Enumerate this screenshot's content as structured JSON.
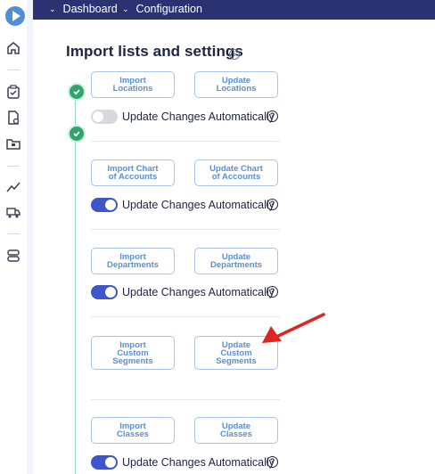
{
  "topbar": {
    "dashboard": "Dashboard",
    "configuration": "Configuration"
  },
  "page": {
    "title": "Import lists and settings",
    "info_icon": "i"
  },
  "sections": [
    {
      "import": "Import\nLocations",
      "update": "Update\nLocations",
      "toggle_label": "Update Changes Automatically",
      "toggle_on": false
    },
    {
      "import": "Import Chart\nof Accounts",
      "update": "Update Chart\nof Accounts",
      "toggle_label": "Update Changes Automatically",
      "toggle_on": true
    },
    {
      "import": "Import\nDepartments",
      "update": "Update\nDepartments",
      "toggle_label": "Update Changes Automatically",
      "toggle_on": true
    },
    {
      "import": "Import\nCustom\nSegments",
      "update": "Update\nCustom\nSegments"
    },
    {
      "import": "Import\nClasses",
      "update": "Update\nClasses",
      "toggle_label": "Update Changes Automatically",
      "toggle_on": true
    }
  ],
  "help_glyph": "?",
  "annotation": {
    "color": "#e02424"
  }
}
